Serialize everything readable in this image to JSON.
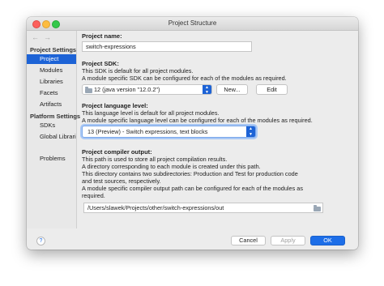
{
  "window": {
    "title": "Project Structure"
  },
  "sidebar": {
    "nav_back": "←",
    "nav_forward": "→",
    "sections": [
      {
        "heading": "Project Settings",
        "items": [
          "Project",
          "Modules",
          "Libraries",
          "Facets",
          "Artifacts"
        ]
      },
      {
        "heading": "Platform Settings",
        "items": [
          "SDKs",
          "Global Libraries"
        ]
      }
    ],
    "problems": "Problems",
    "selected": "Project"
  },
  "project_name": {
    "label": "Project name:",
    "value": "switch-expressions"
  },
  "project_sdk": {
    "label": "Project SDK:",
    "desc1": "This SDK is default for all project modules.",
    "desc2": "A module specific SDK can be configured for each of the modules as required.",
    "value": "12 (java version \"12.0.2\")",
    "new_button": "New...",
    "edit_button": "Edit"
  },
  "language_level": {
    "label": "Project language level:",
    "desc1": "This language level is default for all project modules.",
    "desc2": "A module specific language level can be configured for each of the modules as required.",
    "value": "13 (Preview) - Switch expressions, text blocks"
  },
  "compiler_output": {
    "label": "Project compiler output:",
    "lines": [
      "This path is used to store all project compilation results.",
      "A directory corresponding to each module is created under this path.",
      "This directory contains two subdirectories: Production and Test for production code",
      "and test sources, respectively.",
      "A module specific compiler output path can be configured for each of the modules as",
      "required."
    ],
    "path": "/Users/slawek/Projects/other/switch-expressions/out"
  },
  "footer": {
    "help": "?",
    "cancel": "Cancel",
    "apply": "Apply",
    "ok": "OK"
  }
}
